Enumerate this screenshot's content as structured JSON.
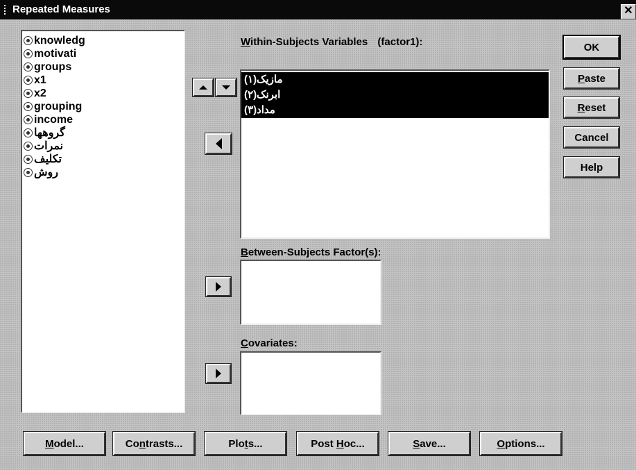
{
  "window": {
    "title": "Repeated Measures",
    "close_glyph": "✕"
  },
  "variables": [
    {
      "name": "knowledg",
      "rtl": false
    },
    {
      "name": "motivati",
      "rtl": false
    },
    {
      "name": "groups",
      "rtl": false
    },
    {
      "name": "x1",
      "rtl": false
    },
    {
      "name": "x2",
      "rtl": false
    },
    {
      "name": "grouping",
      "rtl": false
    },
    {
      "name": "income",
      "rtl": false
    },
    {
      "name": "گروهها",
      "rtl": true
    },
    {
      "name": "نمرات",
      "rtl": true
    },
    {
      "name": "تكليف",
      "rtl": true
    },
    {
      "name": "روش",
      "rtl": true
    }
  ],
  "within": {
    "label_prefix": "W",
    "label_rest": "ithin-Subjects Variables",
    "factor": "(factor1):",
    "items": [
      "(مازیک(۱",
      "(ابرنک(۲",
      "(مداد(۳"
    ]
  },
  "between": {
    "label_prefix": "B",
    "label_rest": "etween-Subjects Factor(s):"
  },
  "covariates": {
    "label_prefix": "C",
    "label_rest": "ovariates:"
  },
  "side_buttons": {
    "ok": "OK",
    "paste_u": "P",
    "paste_rest": "aste",
    "reset_u": "R",
    "reset_rest": "eset",
    "cancel": "Cancel",
    "help": "Help"
  },
  "bottom_buttons": {
    "model_u": "M",
    "model_rest": "odel...",
    "contrasts_a": "Co",
    "contrasts_u": "n",
    "contrasts_b": "trasts...",
    "plots_a": "Plo",
    "plots_u": "t",
    "plots_b": "s...",
    "posthoc_a": "Post ",
    "posthoc_u": "H",
    "posthoc_b": "oc...",
    "save_u": "S",
    "save_rest": "ave...",
    "options_u": "O",
    "options_rest": "ptions..."
  },
  "icons": {
    "variable": "numeric-variable-icon",
    "move_right": "right-arrow-icon",
    "move_left": "left-arrow-icon",
    "up": "up-arrow-icon",
    "down": "down-arrow-icon"
  }
}
